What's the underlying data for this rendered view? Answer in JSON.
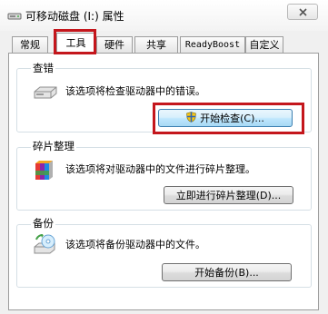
{
  "window": {
    "title": "可移动磁盘 (I:) 属性"
  },
  "tabs": [
    {
      "label": "常规"
    },
    {
      "label": "工具"
    },
    {
      "label": "硬件"
    },
    {
      "label": "共享"
    },
    {
      "label": "ReadyBoost"
    },
    {
      "label": "自定义"
    }
  ],
  "active_tab": "工具",
  "sections": {
    "error_check": {
      "title": "查错",
      "description": "该选项将检查驱动器中的错误。",
      "button_label": "开始检查(C)...",
      "icon": "drive-icon"
    },
    "defrag": {
      "title": "碎片整理",
      "description": "该选项将对驱动器中的文件进行碎片整理。",
      "button_label": "立即进行碎片整理(D)...",
      "icon": "defrag-icon"
    },
    "backup": {
      "title": "备份",
      "description": "该选项将备份驱动器中的文件。",
      "button_label": "开始备份(B)...",
      "icon": "backup-icon"
    }
  },
  "colors": {
    "highlight": "#c4161c",
    "panel_bg": "#ffffff",
    "window_bg": "#f0f0f0"
  }
}
